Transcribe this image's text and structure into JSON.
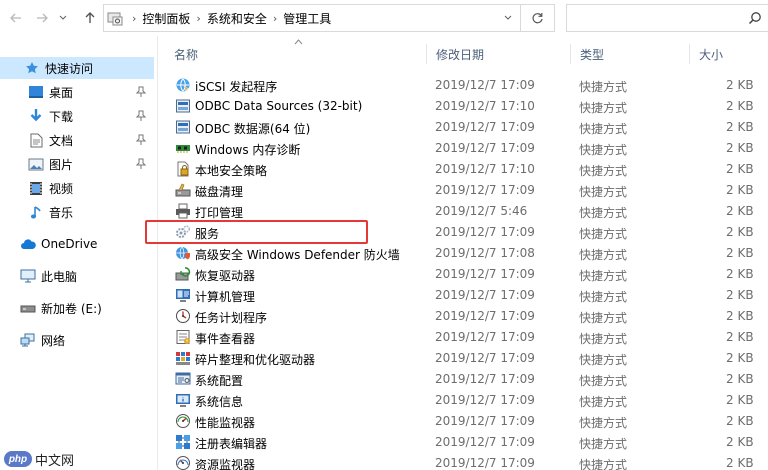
{
  "address": {
    "crumbs": [
      "控制面板",
      "系统和安全",
      "管理工具"
    ]
  },
  "sidebar": {
    "items": [
      {
        "label": "快速访问",
        "icon": "star-icon",
        "pinned": false
      },
      {
        "label": "桌面",
        "icon": "desktop-icon",
        "pinned": true
      },
      {
        "label": "下载",
        "icon": "download-icon",
        "pinned": true
      },
      {
        "label": "文档",
        "icon": "document-icon",
        "pinned": true
      },
      {
        "label": "图片",
        "icon": "picture-icon",
        "pinned": true
      },
      {
        "label": "视频",
        "icon": "video-icon",
        "pinned": false
      },
      {
        "label": "音乐",
        "icon": "music-icon",
        "pinned": false
      },
      {
        "label": "OneDrive",
        "icon": "cloud-icon",
        "pinned": false
      },
      {
        "label": "此电脑",
        "icon": "computer-icon",
        "pinned": false
      },
      {
        "label": "新加卷 (E:)",
        "icon": "drive-icon",
        "pinned": false
      },
      {
        "label": "网络",
        "icon": "network-icon",
        "pinned": false
      }
    ]
  },
  "columns": {
    "name": "名称",
    "date": "修改日期",
    "type": "类型",
    "size": "大小"
  },
  "files": [
    {
      "name": "iSCSI 发起程序",
      "date": "2019/12/7 17:09",
      "type": "快捷方式",
      "size": "2 KB"
    },
    {
      "name": "ODBC Data Sources (32-bit)",
      "date": "2019/12/7 17:10",
      "type": "快捷方式",
      "size": "2 KB"
    },
    {
      "name": "ODBC 数据源(64 位)",
      "date": "2019/12/7 17:09",
      "type": "快捷方式",
      "size": "2 KB"
    },
    {
      "name": "Windows 内存诊断",
      "date": "2019/12/7 17:09",
      "type": "快捷方式",
      "size": "2 KB"
    },
    {
      "name": "本地安全策略",
      "date": "2019/12/7 17:10",
      "type": "快捷方式",
      "size": "2 KB"
    },
    {
      "name": "磁盘清理",
      "date": "2019/12/7 17:09",
      "type": "快捷方式",
      "size": "2 KB"
    },
    {
      "name": "打印管理",
      "date": "2019/12/7 5:46",
      "type": "快捷方式",
      "size": "2 KB"
    },
    {
      "name": "服务",
      "date": "2019/12/7 17:09",
      "type": "快捷方式",
      "size": "2 KB"
    },
    {
      "name": "高级安全 Windows Defender 防火墙",
      "date": "2019/12/7 17:08",
      "type": "快捷方式",
      "size": "2 KB"
    },
    {
      "name": "恢复驱动器",
      "date": "2019/12/7 17:09",
      "type": "快捷方式",
      "size": "2 KB"
    },
    {
      "name": "计算机管理",
      "date": "2019/12/7 17:09",
      "type": "快捷方式",
      "size": "2 KB"
    },
    {
      "name": "任务计划程序",
      "date": "2019/12/7 17:09",
      "type": "快捷方式",
      "size": "2 KB"
    },
    {
      "name": "事件查看器",
      "date": "2019/12/7 17:09",
      "type": "快捷方式",
      "size": "2 KB"
    },
    {
      "name": "碎片整理和优化驱动器",
      "date": "2019/12/7 17:09",
      "type": "快捷方式",
      "size": "2 KB"
    },
    {
      "name": "系统配置",
      "date": "2019/12/7 17:09",
      "type": "快捷方式",
      "size": "2 KB"
    },
    {
      "name": "系统信息",
      "date": "2019/12/7 17:09",
      "type": "快捷方式",
      "size": "2 KB"
    },
    {
      "name": "性能监视器",
      "date": "2019/12/7 17:09",
      "type": "快捷方式",
      "size": "2 KB"
    },
    {
      "name": "注册表编辑器",
      "date": "2019/12/7 17:09",
      "type": "快捷方式",
      "size": "2 KB"
    },
    {
      "name": "资源监视器",
      "date": "2019/12/7 17:09",
      "type": "快捷方式",
      "size": "2 KB"
    }
  ],
  "watermark": {
    "logo": "php",
    "text": "中文网"
  },
  "colors": {
    "selected_bg": "#cce8ff",
    "highlight": "#e53935",
    "header_text": "#4c607a"
  }
}
